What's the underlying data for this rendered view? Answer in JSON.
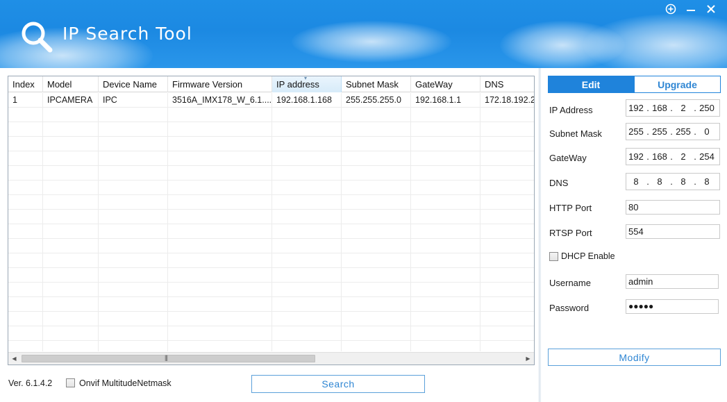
{
  "window": {
    "title": "IP Search Tool",
    "controls": {
      "add": "⊕",
      "minimize": "—",
      "close": "✕"
    }
  },
  "colors": {
    "titlebar": "#1c89e2",
    "accent": "#1f83db",
    "button_text": "#2f86d3"
  },
  "table": {
    "columns": [
      "Index",
      "Model",
      "Device Name",
      "Firmware Version",
      "IP address",
      "Subnet Mask",
      "GateWay",
      "DNS"
    ],
    "sorted_column": "IP address",
    "rows": [
      [
        "1",
        "IPCAMERA",
        "IPC",
        "3516A_IMX178_W_6.1....",
        "192.168.1.168",
        "255.255.255.0",
        "192.168.1.1",
        "172.18.192.2"
      ]
    ]
  },
  "footer": {
    "version": "Ver. 6.1.4.2",
    "onvif_label": "Onvif MultitudeNetmask",
    "onvif_checked": false,
    "search_button": "Search"
  },
  "panel": {
    "tabs": [
      {
        "label": "Edit",
        "active": true
      },
      {
        "label": "Upgrade",
        "active": false
      }
    ],
    "ip_fields": [
      {
        "label": "IP Address",
        "octets": [
          "192",
          "168",
          "2",
          "250"
        ]
      },
      {
        "label": "Subnet Mask",
        "octets": [
          "255",
          "255",
          "255",
          "0"
        ]
      },
      {
        "label": "GateWay",
        "octets": [
          "192",
          "168",
          "2",
          "254"
        ]
      },
      {
        "label": "DNS",
        "octets": [
          "8",
          "8",
          "8",
          "8"
        ]
      }
    ],
    "http_port": {
      "label": "HTTP Port",
      "value": "80"
    },
    "rtsp_port": {
      "label": "RTSP Port",
      "value": "554"
    },
    "dhcp": {
      "label": "DHCP Enable",
      "checked": false
    },
    "username": {
      "label": "Username",
      "value": "admin"
    },
    "password": {
      "label": "Password",
      "value": "●●●●●"
    },
    "modify_button": "Modify"
  }
}
